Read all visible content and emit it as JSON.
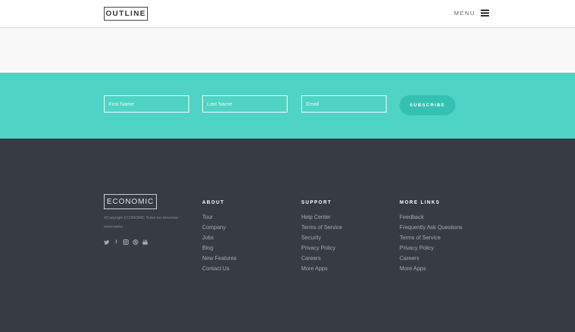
{
  "header": {
    "logo": "OUTLINE",
    "menu_label": "MENU",
    "menu_icon": "hamburger-icon"
  },
  "subscribe": {
    "first_name_placeholder": "First Name",
    "last_name_placeholder": "Last Name",
    "email_placeholder": "Email",
    "button_label": "SUBSCRIBE"
  },
  "footer": {
    "brand": "ECONOMIC",
    "copyright": "©Copyright ECONOMIC Todos los derechos reservados.",
    "social_icons": [
      "twitter-icon",
      "facebook-icon",
      "instagram-icon",
      "dribbble-icon",
      "youtube-icon"
    ],
    "columns": [
      {
        "title": "ABOUT",
        "links": [
          "Tour",
          "Company",
          "Jobs",
          "Blog",
          "New Features",
          "Contact Us"
        ]
      },
      {
        "title": "SUPPORT",
        "links": [
          "Help Center",
          "Terms of Service",
          "Security",
          "Privacy Policy",
          "Careers",
          "More Apps"
        ]
      },
      {
        "title": "MORE LINKS",
        "links": [
          "Feedback",
          "Frequently Ask Questions",
          "Terms of Service",
          "Privacy Policy",
          "Careers",
          "More Apps"
        ]
      }
    ]
  },
  "colors": {
    "band": "#4fd3c5",
    "button": "#34c1b2",
    "footer": "#373b43"
  }
}
